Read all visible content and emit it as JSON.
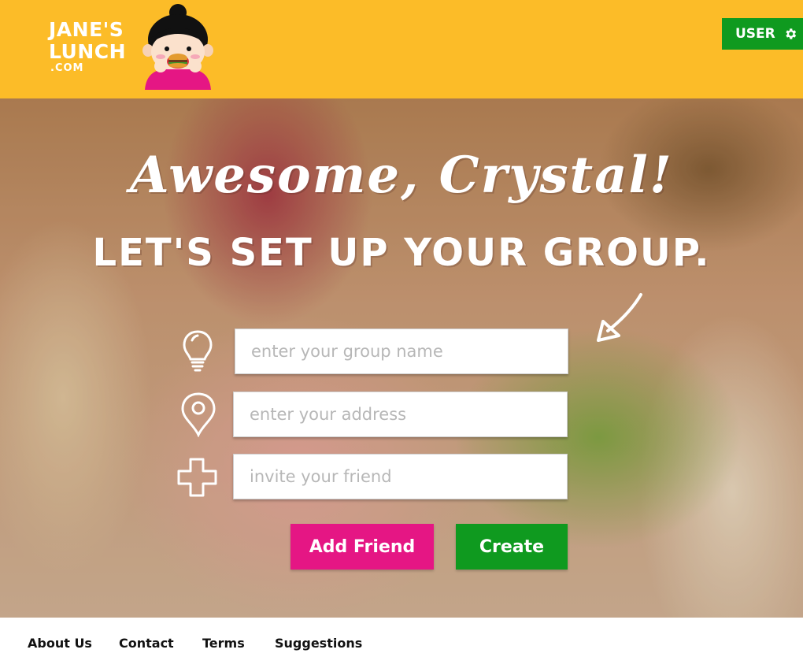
{
  "header": {
    "logo": {
      "line1": "JANE'S",
      "line2": "LUNCH",
      "line3": ".COM"
    },
    "user_button": {
      "label": "USER",
      "icon": "gear-icon"
    },
    "brand_color": "#fcbc28"
  },
  "hero": {
    "headline_script": "Awesome, Crystal!",
    "headline_block": "LET'S SET UP YOUR GROUP.",
    "arrow_icon": "arrow-down-left-icon"
  },
  "form": {
    "group_name": {
      "placeholder": "enter your group name",
      "value": "",
      "icon": "lightbulb-icon"
    },
    "address": {
      "placeholder": "enter your address",
      "value": "",
      "icon": "map-pin-icon"
    },
    "friend": {
      "placeholder": "invite your friend",
      "value": "",
      "icon": "plus-icon"
    },
    "add_friend_label": "Add Friend",
    "create_label": "Create",
    "add_friend_color": "#e51684",
    "create_color": "#0f9a1f"
  },
  "footer": {
    "links": [
      "About Us",
      "Contact",
      "Terms",
      "Suggestions"
    ]
  }
}
